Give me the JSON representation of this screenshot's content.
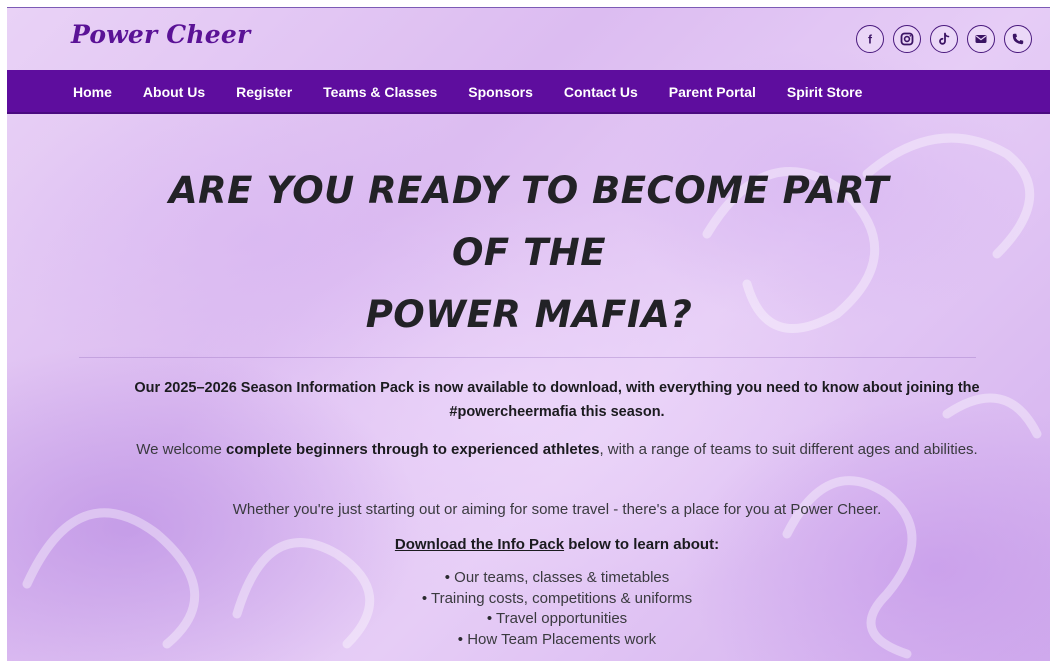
{
  "site": {
    "logo": "Power Cheer",
    "social": [
      {
        "icon": "facebook-icon",
        "glyph": "f"
      },
      {
        "icon": "instagram-icon"
      },
      {
        "icon": "tiktok-icon"
      },
      {
        "icon": "email-icon"
      },
      {
        "icon": "phone-icon"
      }
    ]
  },
  "nav": {
    "items": [
      "Home",
      "About Us",
      "Register",
      "Teams & Classes",
      "Sponsors",
      "Contact Us",
      "Parent Portal",
      "Spirit Store"
    ]
  },
  "hero": {
    "line1": "ARE YOU READY TO BECOME PART",
    "line2": "OF THE",
    "line3": "POWER MAFIA?"
  },
  "content": {
    "intro": "Our 2025–2026 Season Information Pack is now available to download, with everything you need to know about joining the #powercheermafia this season.",
    "welcome_pre": "We welcome ",
    "welcome_bold": "complete beginners through to experienced athletes",
    "welcome_post": ", with a range of teams to suit different ages and abilities.",
    "whether": "Whether you're just starting out or aiming for some travel - there's a place for you at Power Cheer.",
    "download_link": "Download the Info Pack",
    "download_rest": " below to learn about:",
    "bullets": [
      "Our teams, classes & timetables",
      "Training costs, competitions & uniforms",
      "Travel opportunities",
      "How Team Placements work"
    ]
  },
  "colors": {
    "brand_purple": "#5e0d9e",
    "logo_purple": "#5a1296",
    "background_lilac": "#e2c8f4"
  }
}
